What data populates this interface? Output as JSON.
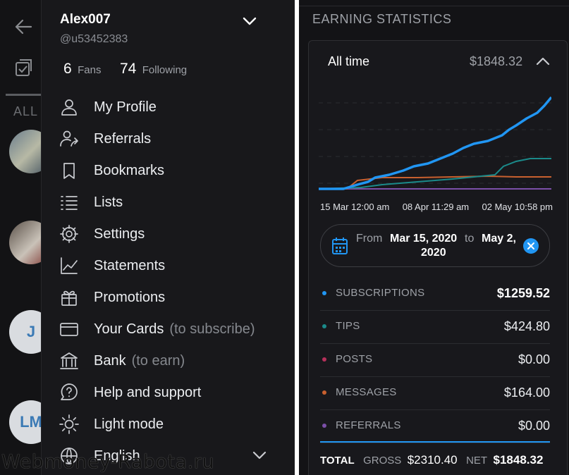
{
  "background_feed": {
    "tab_label": "ALL",
    "avatars": [
      {
        "type": "photo"
      },
      {
        "type": "photo"
      },
      {
        "type": "letter",
        "initials": "J"
      },
      {
        "type": "letter",
        "initials": "LM"
      }
    ]
  },
  "menu": {
    "username": "Alex007",
    "handle": "@u53452383",
    "fans_count": "6",
    "fans_label": "Fans",
    "following_count": "74",
    "following_label": "Following",
    "items": [
      {
        "label": "My Profile",
        "icon": "user-icon"
      },
      {
        "label": "Referrals",
        "icon": "referrals-icon"
      },
      {
        "label": "Bookmarks",
        "icon": "bookmark-icon"
      },
      {
        "label": "Lists",
        "icon": "list-icon"
      },
      {
        "label": "Settings",
        "icon": "gear-icon"
      },
      {
        "label": "Statements",
        "icon": "chart-line-icon"
      },
      {
        "label": "Promotions",
        "icon": "gift-icon"
      },
      {
        "label": "Your Cards",
        "hint": "(to subscribe)",
        "icon": "card-icon"
      },
      {
        "label": "Bank",
        "hint": "(to earn)",
        "icon": "bank-icon"
      },
      {
        "label": "Help and support",
        "icon": "help-icon"
      },
      {
        "label": "Light mode",
        "icon": "sun-icon"
      },
      {
        "label": "English",
        "icon": "globe-icon"
      }
    ]
  },
  "watermark": "Webmoney-Rabota.ru",
  "earnings": {
    "section_title": "EARNING STATISTICS",
    "period_label": "All time",
    "period_total": "$1848.32",
    "date_ticks": [
      "15 Mar 12:00 am",
      "08 Apr 11:29 am",
      "02 May 10:58 pm"
    ],
    "range": {
      "from_label": "From",
      "start": "Mar 15, 2020",
      "to_label": "to",
      "end_line1": "May 2,",
      "end_line2": "2020"
    },
    "rows": [
      {
        "label": "SUBSCRIPTIONS",
        "value": "$1259.52",
        "color": "#2196f3"
      },
      {
        "label": "TIPS",
        "value": "$424.80",
        "color": "#1b8a8a"
      },
      {
        "label": "POSTS",
        "value": "$0.00",
        "color": "#b5305a"
      },
      {
        "label": "MESSAGES",
        "value": "$164.00",
        "color": "#c8602f"
      },
      {
        "label": "REFERRALS",
        "value": "$0.00",
        "color": "#7b4fa8"
      }
    ],
    "totals": {
      "total_label": "TOTAL",
      "gross_label": "GROSS",
      "gross_value": "$2310.40",
      "net_label": "NET",
      "net_value": "$1848.32"
    }
  },
  "colors": {
    "accent": "#2196f3",
    "tips": "#1b8a8a",
    "posts": "#b5305a",
    "messages": "#c8602f",
    "referrals": "#7b4fa8"
  }
}
